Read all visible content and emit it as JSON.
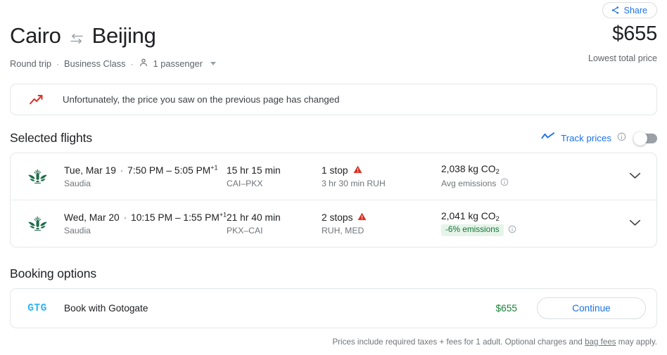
{
  "header": {
    "share_label": "Share",
    "share_icon": "share-icon",
    "origin": "Cairo",
    "destination": "Beijing",
    "swap_icon": "swap-arrows-icon",
    "trip_type": "Round trip",
    "cabin_class": "Business Class",
    "passengers": "1 passenger",
    "passenger_icon": "person-icon",
    "separator": "·",
    "total_price": "$655",
    "price_caption": "Lowest total price"
  },
  "alert": {
    "icon": "trending-up-icon",
    "message": "Unfortunately, the price you saw on the previous page has changed",
    "icon_color": "#d93025"
  },
  "selected_flights": {
    "title": "Selected flights",
    "track_prices_label": "Track prices",
    "track_prices_icon": "price-graph-icon",
    "info_icon": "info-icon",
    "toggle_state": "off",
    "accent_color": "#1a73e8",
    "flights": [
      {
        "airline_logo": "saudia-logo",
        "date": "Tue, Mar 19",
        "times": "7:50 PM – 5:05 PM",
        "day_offset": "+1",
        "airline": "Saudia",
        "duration": "15 hr 15 min",
        "route": "CAI–PKX",
        "stops": "1 stop",
        "warning_icon": "warning-triangle-icon",
        "layover": "3 hr 30 min RUH",
        "co2": "2,038 kg CO",
        "co2_subscript": "2",
        "emissions_note": "Avg emissions",
        "emissions_badge": "",
        "chevron_icon": "chevron-down-icon"
      },
      {
        "airline_logo": "saudia-logo",
        "date": "Wed, Mar 20",
        "times": "10:15 PM – 1:55 PM",
        "day_offset": "+1",
        "airline": "Saudia",
        "duration": "21 hr 40 min",
        "route": "PKX–CAI",
        "stops": "2 stops",
        "warning_icon": "warning-triangle-icon",
        "layover": "RUH, MED",
        "co2": "2,041 kg CO",
        "co2_subscript": "2",
        "emissions_note": "",
        "emissions_badge": "-6% emissions",
        "chevron_icon": "chevron-down-icon"
      }
    ]
  },
  "booking_options": {
    "title": "Booking options",
    "provider_logo": "GTG",
    "provider_label": "Book with Gotogate",
    "price": "$655",
    "continue_label": "Continue",
    "price_color": "#188038"
  },
  "footer": {
    "text_before": "Prices include required taxes + fees for 1 adult. Optional charges and ",
    "link": "bag fees",
    "text_after": " may apply."
  }
}
